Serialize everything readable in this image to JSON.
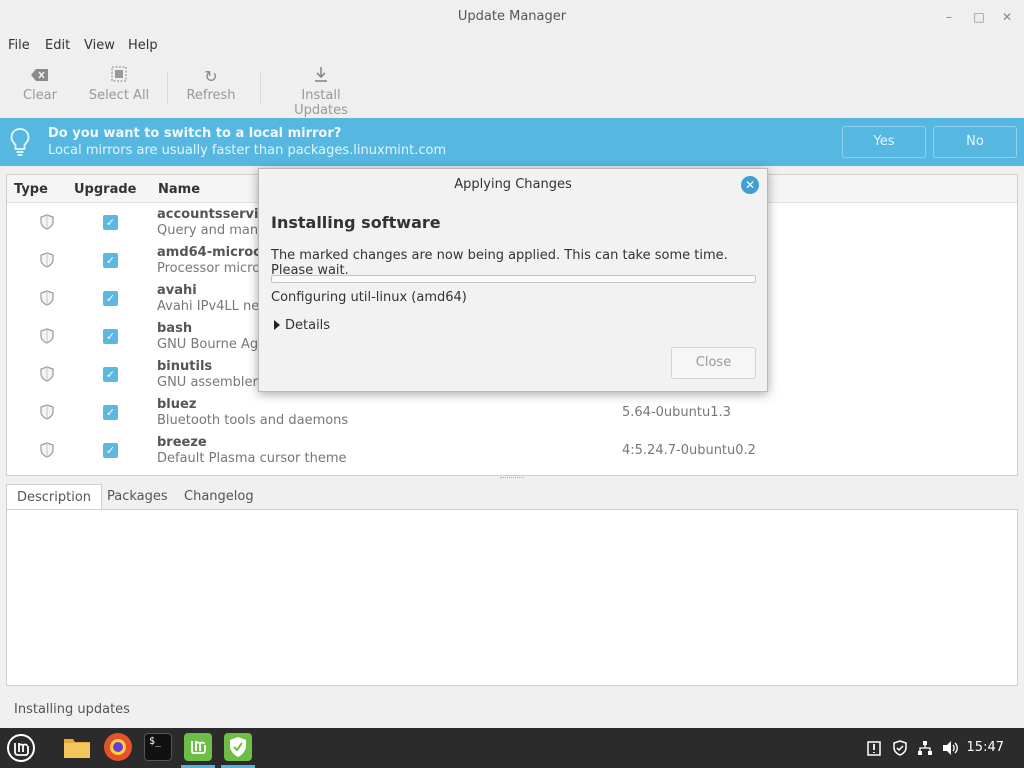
{
  "window": {
    "title": "Update Manager"
  },
  "menu": [
    "File",
    "Edit",
    "View",
    "Help"
  ],
  "toolbar": [
    {
      "label": "Clear",
      "icon": "backspace-icon"
    },
    {
      "label": "Select All",
      "icon": "select-all-icon"
    },
    {
      "label": "Refresh",
      "icon": "refresh-icon"
    },
    {
      "label": "Install Updates",
      "icon": "download-icon"
    }
  ],
  "banner": {
    "title": "Do you want to switch to a local mirror?",
    "subtitle": "Local mirrors are usually faster than packages.linuxmint.com",
    "yes": "Yes",
    "no": "No"
  },
  "list": {
    "headers": {
      "type": "Type",
      "upgrade": "Upgrade",
      "name": "Name"
    },
    "rows": [
      {
        "name": "accountsservice",
        "desc": "Query and manip",
        "version": ""
      },
      {
        "name": "amd64-microcod",
        "desc": "Processor microc",
        "version": ""
      },
      {
        "name": "avahi",
        "desc": "Avahi IPv4LL net",
        "version": ""
      },
      {
        "name": "bash",
        "desc": "GNU Bourne Aga",
        "version": ""
      },
      {
        "name": "binutils",
        "desc": "GNU assembler, l",
        "version": ""
      },
      {
        "name": "bluez",
        "desc": "Bluetooth tools and daemons",
        "version": "5.64-0ubuntu1.3"
      },
      {
        "name": "breeze",
        "desc": "Default Plasma cursor theme",
        "version": "4:5.24.7-0ubuntu0.2"
      }
    ]
  },
  "tabs": [
    "Description",
    "Packages",
    "Changelog"
  ],
  "status": "Installing updates",
  "dialog": {
    "title": "Applying Changes",
    "heading": "Installing software",
    "message": "The marked changes are now being applied. This can take some time. Please wait.",
    "configuring": "Configuring util-linux (amd64)",
    "details": "Details",
    "close": "Close",
    "progress": 0
  },
  "taskbar": {
    "time": "15:47"
  },
  "colors": {
    "accent": "#56b8e0",
    "check": "#5cb8e0",
    "taskbar": "#2b2b2b"
  }
}
